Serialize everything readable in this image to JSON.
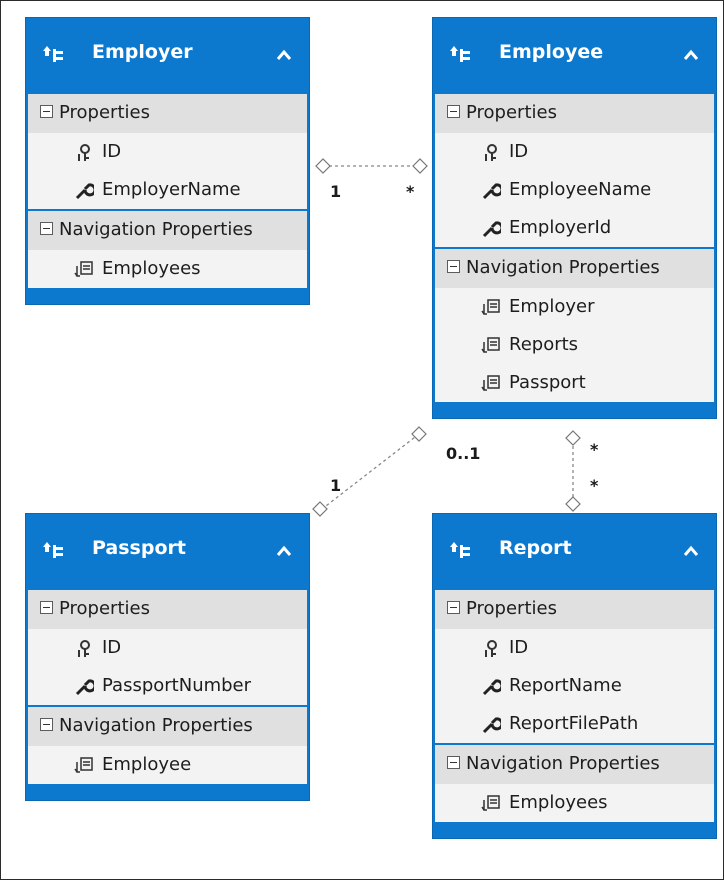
{
  "entities": {
    "employer": {
      "title": "Employer",
      "properties_label": "Properties",
      "properties": [
        "ID",
        "EmployerName"
      ],
      "nav_label": "Navigation Properties",
      "navigation": [
        "Employees"
      ]
    },
    "employee": {
      "title": "Employee",
      "properties_label": "Properties",
      "properties": [
        "ID",
        "EmployeeName",
        "EmployerId"
      ],
      "nav_label": "Navigation Properties",
      "navigation": [
        "Employer",
        "Reports",
        "Passport"
      ]
    },
    "passport": {
      "title": "Passport",
      "properties_label": "Properties",
      "properties": [
        "ID",
        "PassportNumber"
      ],
      "nav_label": "Navigation Properties",
      "navigation": [
        "Employee"
      ]
    },
    "report": {
      "title": "Report",
      "properties_label": "Properties",
      "properties": [
        "ID",
        "ReportName",
        "ReportFilePath"
      ],
      "nav_label": "Navigation Properties",
      "navigation": [
        "Employees"
      ]
    }
  },
  "associations": {
    "employer_employee": {
      "from_mult": "1",
      "to_mult": "*"
    },
    "employee_passport": {
      "from_mult": "0..1",
      "to_mult": "1"
    },
    "employee_report": {
      "from_mult": "*",
      "to_mult": "*"
    }
  },
  "colors": {
    "header": "#0c79cf",
    "section": "#e0e0e0",
    "body": "#f3f3f3"
  }
}
